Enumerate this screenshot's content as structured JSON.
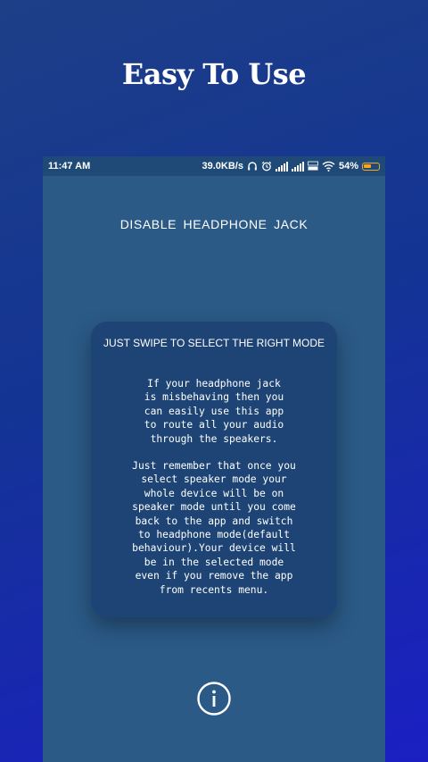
{
  "promo": {
    "title": "Easy To Use"
  },
  "status_bar": {
    "time": "11:47 AM",
    "network_speed": "39.0KB/s",
    "battery_percent": "54%",
    "battery_level": 0.54,
    "icons": [
      "headphones-icon",
      "alarm-icon",
      "signal-icon",
      "signal-icon",
      "volte-icon",
      "wifi-icon",
      "battery-icon"
    ],
    "battery_color": "#f5a623"
  },
  "app": {
    "title": "DISABLE  HEADPHONE  JACK",
    "background_color": "#2b5a87"
  },
  "card": {
    "heading": "JUST SWIPE TO SELECT THE RIGHT MODE",
    "paragraph1": "If your headphone jack\nis misbehaving then you\ncan easily use this app\nto route all your audio\nthrough the speakers.",
    "paragraph2": "Just remember that once you\nselect speaker mode your\nwhole device will be on\nspeaker mode until you come\nback to the app and switch\nto headphone mode(default\nbehaviour).Your device will\nbe in the selected mode\neven if you remove the app\nfrom recents menu.",
    "background_color": "#1d4474"
  },
  "info_button": {
    "icon": "info-icon"
  }
}
